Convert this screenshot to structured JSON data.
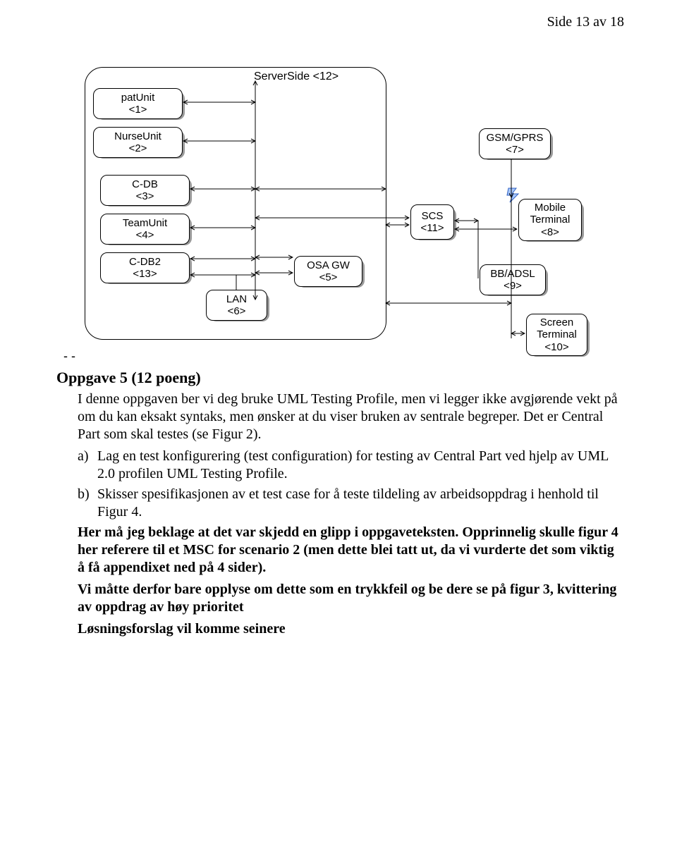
{
  "page_number": "Side 13 av 18",
  "diagram": {
    "server_title": "ServerSide <12>",
    "nodes": {
      "patunit": "patUnit\n<1>",
      "nurseunit": "NurseUnit\n<2>",
      "cdb": "C-DB\n<3>",
      "teamunit": "TeamUnit\n<4>",
      "cdb2": "C-DB2\n<13>",
      "lan": "LAN\n<6>",
      "osagw": "OSA GW\n<5>",
      "scs": "SCS\n<11>",
      "gsm": "GSM/GPRS\n<7>",
      "mobile": "Mobile\nTerminal\n<8>",
      "bbadsl": "BB/ADSL\n<9>",
      "screen": "Screen\nTerminal\n<10>"
    },
    "dash": "- -"
  },
  "body": {
    "heading": "Oppgave 5 (12 poeng)",
    "intro": "I denne oppgaven ber vi deg bruke UML Testing Profile, men vi legger ikke avgjørende vekt på om du kan eksakt syntaks, men ønsker at du viser bruken av sentrale begreper. Det er Central Part som skal testes (se Figur 2).",
    "item_a_letter": "a)",
    "item_a": "Lag en test konfigurering (test configuration) for testing av Central Part ved hjelp av UML 2.0 profilen UML Testing Profile.",
    "item_b_letter": "b)",
    "item_b": "Skisser spesifikasjonen av et test case for å teste tildeling av arbeidsoppdrag i henhold til Figur 4.",
    "bold1": "Her må jeg beklage at det var skjedd en glipp i oppgaveteksten. Opprinnelig skulle figur 4 her referere til et MSC for scenario 2 (men dette blei tatt ut, da vi vurderte det som viktig å få appendixet ned på 4 sider).",
    "bold2": "Vi måtte derfor bare opplyse om dette som en trykkfeil og be dere se på figur 3, kvittering av oppdrag av høy prioritet",
    "bold3": "Løsningsforslag vil komme seinere"
  }
}
